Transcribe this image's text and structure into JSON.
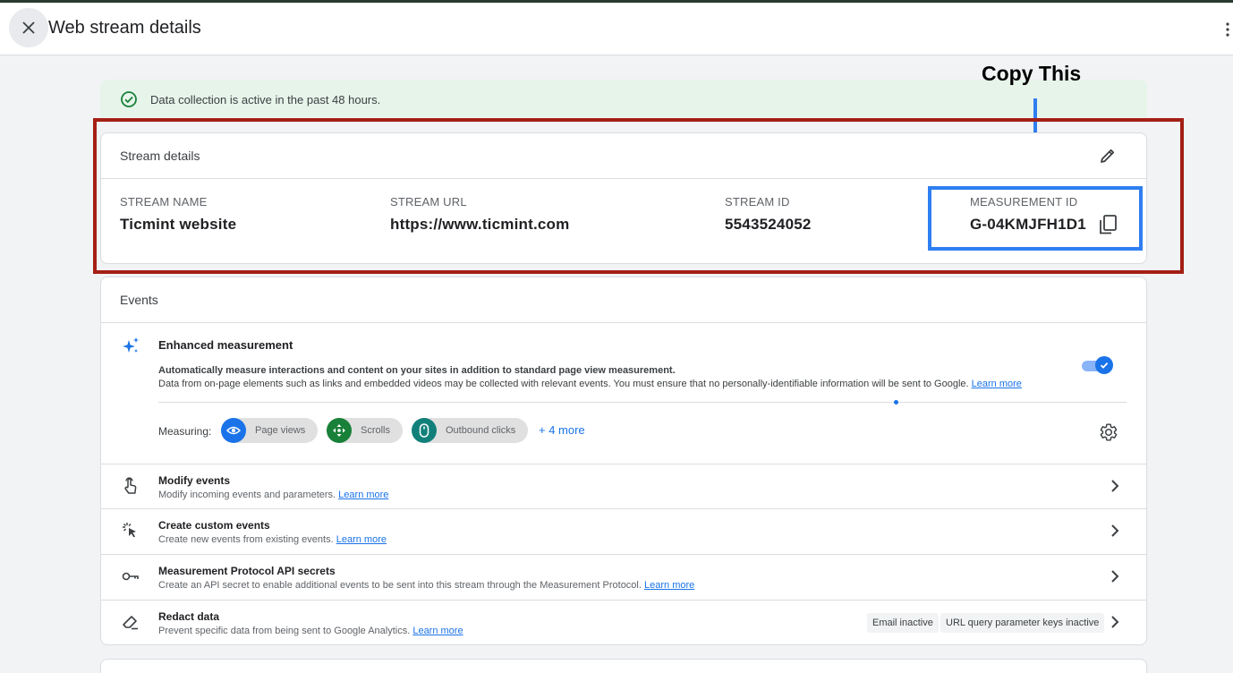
{
  "header": {
    "title": "Web stream details"
  },
  "banner": {
    "text": "Data collection is active in the past 48 hours."
  },
  "annotation": {
    "label": "Copy This"
  },
  "stream_details": {
    "title": "Stream details",
    "fields": [
      {
        "label": "STREAM NAME",
        "value": "Ticmint website"
      },
      {
        "label": "STREAM URL",
        "value": "https://www.ticmint.com"
      },
      {
        "label": "STREAM ID",
        "value": "5543524052"
      },
      {
        "label": "MEASUREMENT ID",
        "value": "G-04KMJFH1D1"
      }
    ]
  },
  "events": {
    "title": "Events",
    "enhanced": {
      "title": "Enhanced measurement",
      "desc_bold": "Automatically measure interactions and content on your sites in addition to standard page view measurement.",
      "desc": "Data from on-page elements such as links and embedded videos may be collected with relevant events. You must ensure that no personally-identifiable information will be sent to Google.",
      "learn_more": "Learn more",
      "enabled": true,
      "measuring_label": "Measuring:",
      "chips": [
        {
          "label": "Page views",
          "color": "#1a73e8",
          "icon": "eye-icon"
        },
        {
          "label": "Scrolls",
          "color": "#188038",
          "icon": "move-arrows-icon"
        },
        {
          "label": "Outbound clicks",
          "color": "#12807a",
          "icon": "mouse-icon"
        }
      ],
      "more": "+ 4 more"
    },
    "rows": [
      {
        "title": "Modify events",
        "desc": "Modify incoming events and parameters.",
        "learn_more": "Learn more",
        "icon": "touch-hand-icon"
      },
      {
        "title": "Create custom events",
        "desc": "Create new events from existing events.",
        "learn_more": "Learn more",
        "icon": "cursor-click-icon"
      },
      {
        "title": "Measurement Protocol API secrets",
        "desc": "Create an API secret to enable additional events to be sent into this stream through the Measurement Protocol.",
        "learn_more": "Learn more",
        "icon": "key-icon"
      },
      {
        "title": "Redact data",
        "desc": "Prevent specific data from being sent to Google Analytics.",
        "learn_more": "Learn more",
        "icon": "eraser-icon",
        "badges": [
          "Email inactive",
          "URL query parameter keys inactive"
        ]
      }
    ]
  },
  "colors": {
    "accent": "#1a73e8",
    "success": "#188038",
    "annotation_red": "#a41f14",
    "annotation_blue": "#2f7ef1"
  }
}
